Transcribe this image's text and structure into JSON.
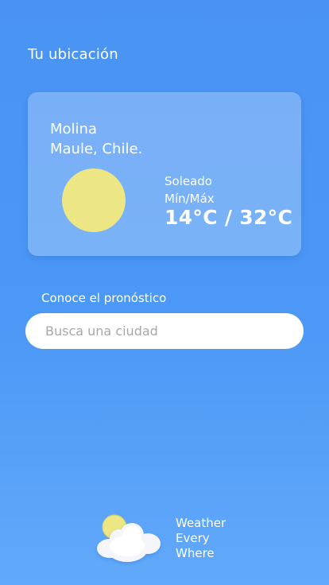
{
  "header": {
    "title": "Tu ubicación"
  },
  "weather_card": {
    "city_line1": "Molina",
    "city_line2": "Maule, Chile.",
    "condition": "Soleado",
    "minmax_label": "Mín/Máx",
    "temperature_range": "14°C / 32°C",
    "icon": "sun-icon",
    "sun_color": "#ede685"
  },
  "forecast": {
    "label": "Conoce el pronóstico",
    "search_placeholder": "Busca una ciudad",
    "search_value": ""
  },
  "footer": {
    "logo_icon": "partly-cloudy-icon",
    "brand_line1": "Weather",
    "brand_line2": "Every",
    "brand_line3": "Where"
  },
  "colors": {
    "background": "#4a93f3",
    "card": "rgba(255,255,255,0.26)",
    "text": "#ffffff"
  }
}
